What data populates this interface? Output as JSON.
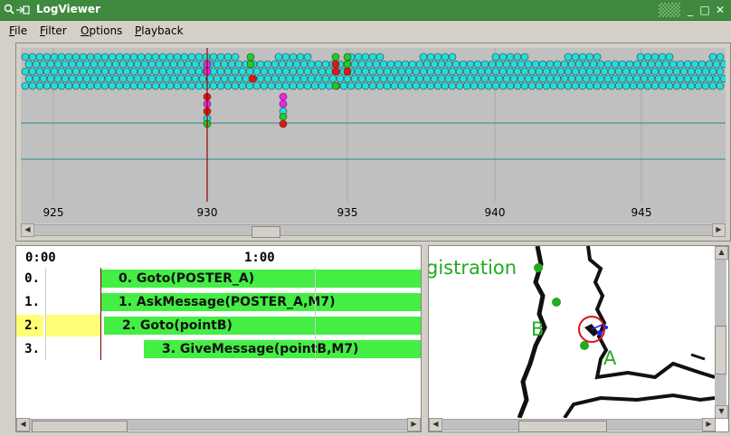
{
  "window": {
    "title": "LogViewer",
    "accent": "#3f8a3f"
  },
  "menu": {
    "items": [
      {
        "label": "File",
        "accel": "F"
      },
      {
        "label": "Filter",
        "accel": "F"
      },
      {
        "label": "Options",
        "accel": "O"
      },
      {
        "label": "Playback",
        "accel": "P"
      }
    ]
  },
  "timeline": {
    "ticks": [
      "925",
      "930",
      "935",
      "940",
      "945"
    ],
    "cursor_tick": "930",
    "dot_colors": {
      "cyan": "#22dddd",
      "green": "#22cc22",
      "red": "#ee1111",
      "magenta": "#ee22ee"
    }
  },
  "tasks": {
    "time_labels": [
      "0:00",
      "1:00"
    ],
    "rows": [
      {
        "index": "0.",
        "label": "0. Goto(POSTER_A)",
        "selected": false
      },
      {
        "index": "1.",
        "label": "1. AskMessage(POSTER_A,M7)",
        "selected": false
      },
      {
        "index": "2.",
        "label": "2. Goto(pointB)",
        "selected": true
      },
      {
        "index": "3.",
        "label": "3. GiveMessage(pointB,M7)",
        "selected": false
      }
    ],
    "bar_color": "#44ee44",
    "selected_color": "#ffff77"
  },
  "map": {
    "labels": [
      "gistration",
      "B",
      "A"
    ],
    "label_color": "#22aa22"
  }
}
